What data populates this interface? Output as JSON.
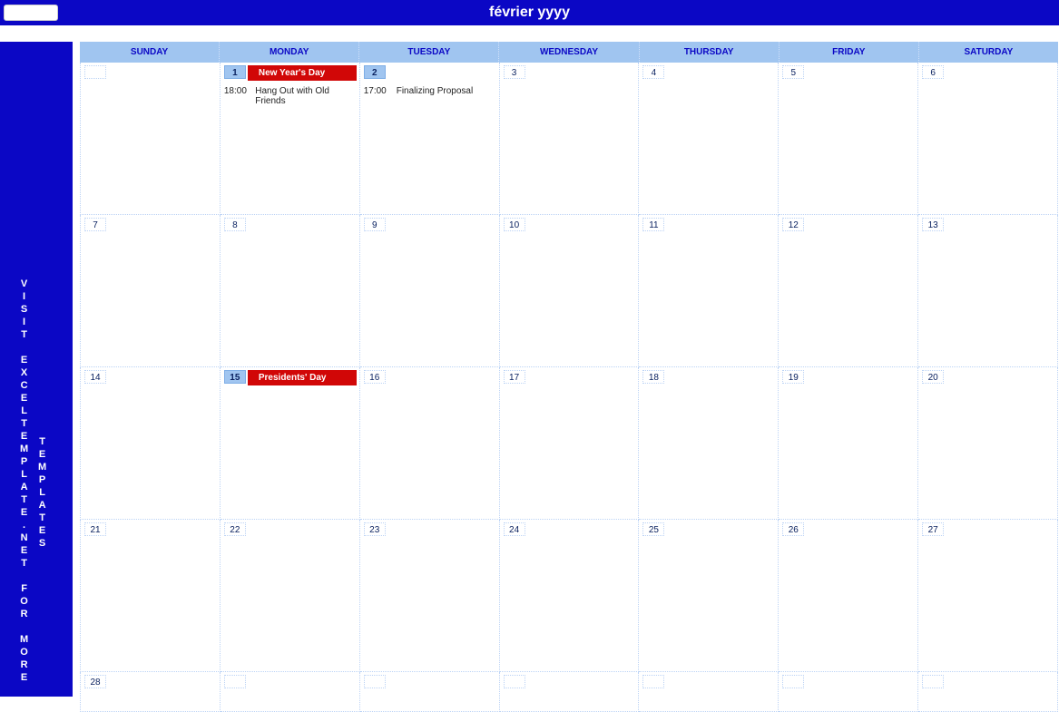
{
  "titlebar": {
    "input_value": "",
    "title": "février yyyy"
  },
  "sidebar": {
    "line1": "V\nI\nS\nI\nT\n\nE\nX\nC\nE\nL\nT\nE\nM\nP\nL\nA\nT\nE\n.\nN\nE\nT\n\nF\nO\nR\n\nM\nO\nR\nE",
    "line2": "T\nE\nM\nP\nL\nA\nT\nE\nS"
  },
  "weekdays": [
    "SUNDAY",
    "MONDAY",
    "TUESDAY",
    "WEDNESDAY",
    "THURSDAY",
    "FRIDAY",
    "SATURDAY"
  ],
  "weeks": [
    [
      {
        "num": ""
      },
      {
        "num": "1",
        "hl": true,
        "holiday": "New Year's Day",
        "event": {
          "time": "18:00",
          "text": "Hang Out with Old Friends"
        }
      },
      {
        "num": "2",
        "hl": true,
        "event": {
          "time": "17:00",
          "text": "Finalizing Proposal"
        }
      },
      {
        "num": "3"
      },
      {
        "num": "4"
      },
      {
        "num": "5"
      },
      {
        "num": "6"
      }
    ],
    [
      {
        "num": "7"
      },
      {
        "num": "8"
      },
      {
        "num": "9"
      },
      {
        "num": "10"
      },
      {
        "num": "11"
      },
      {
        "num": "12"
      },
      {
        "num": "13"
      }
    ],
    [
      {
        "num": "14"
      },
      {
        "num": "15",
        "hl": true,
        "holiday": "Presidents' Day"
      },
      {
        "num": "16"
      },
      {
        "num": "17"
      },
      {
        "num": "18"
      },
      {
        "num": "19"
      },
      {
        "num": "20"
      }
    ],
    [
      {
        "num": "21"
      },
      {
        "num": "22"
      },
      {
        "num": "23"
      },
      {
        "num": "24"
      },
      {
        "num": "25"
      },
      {
        "num": "26"
      },
      {
        "num": "27"
      }
    ],
    [
      {
        "num": "28"
      },
      {
        "num": ""
      },
      {
        "num": ""
      },
      {
        "num": ""
      },
      {
        "num": ""
      },
      {
        "num": ""
      },
      {
        "num": ""
      }
    ]
  ]
}
